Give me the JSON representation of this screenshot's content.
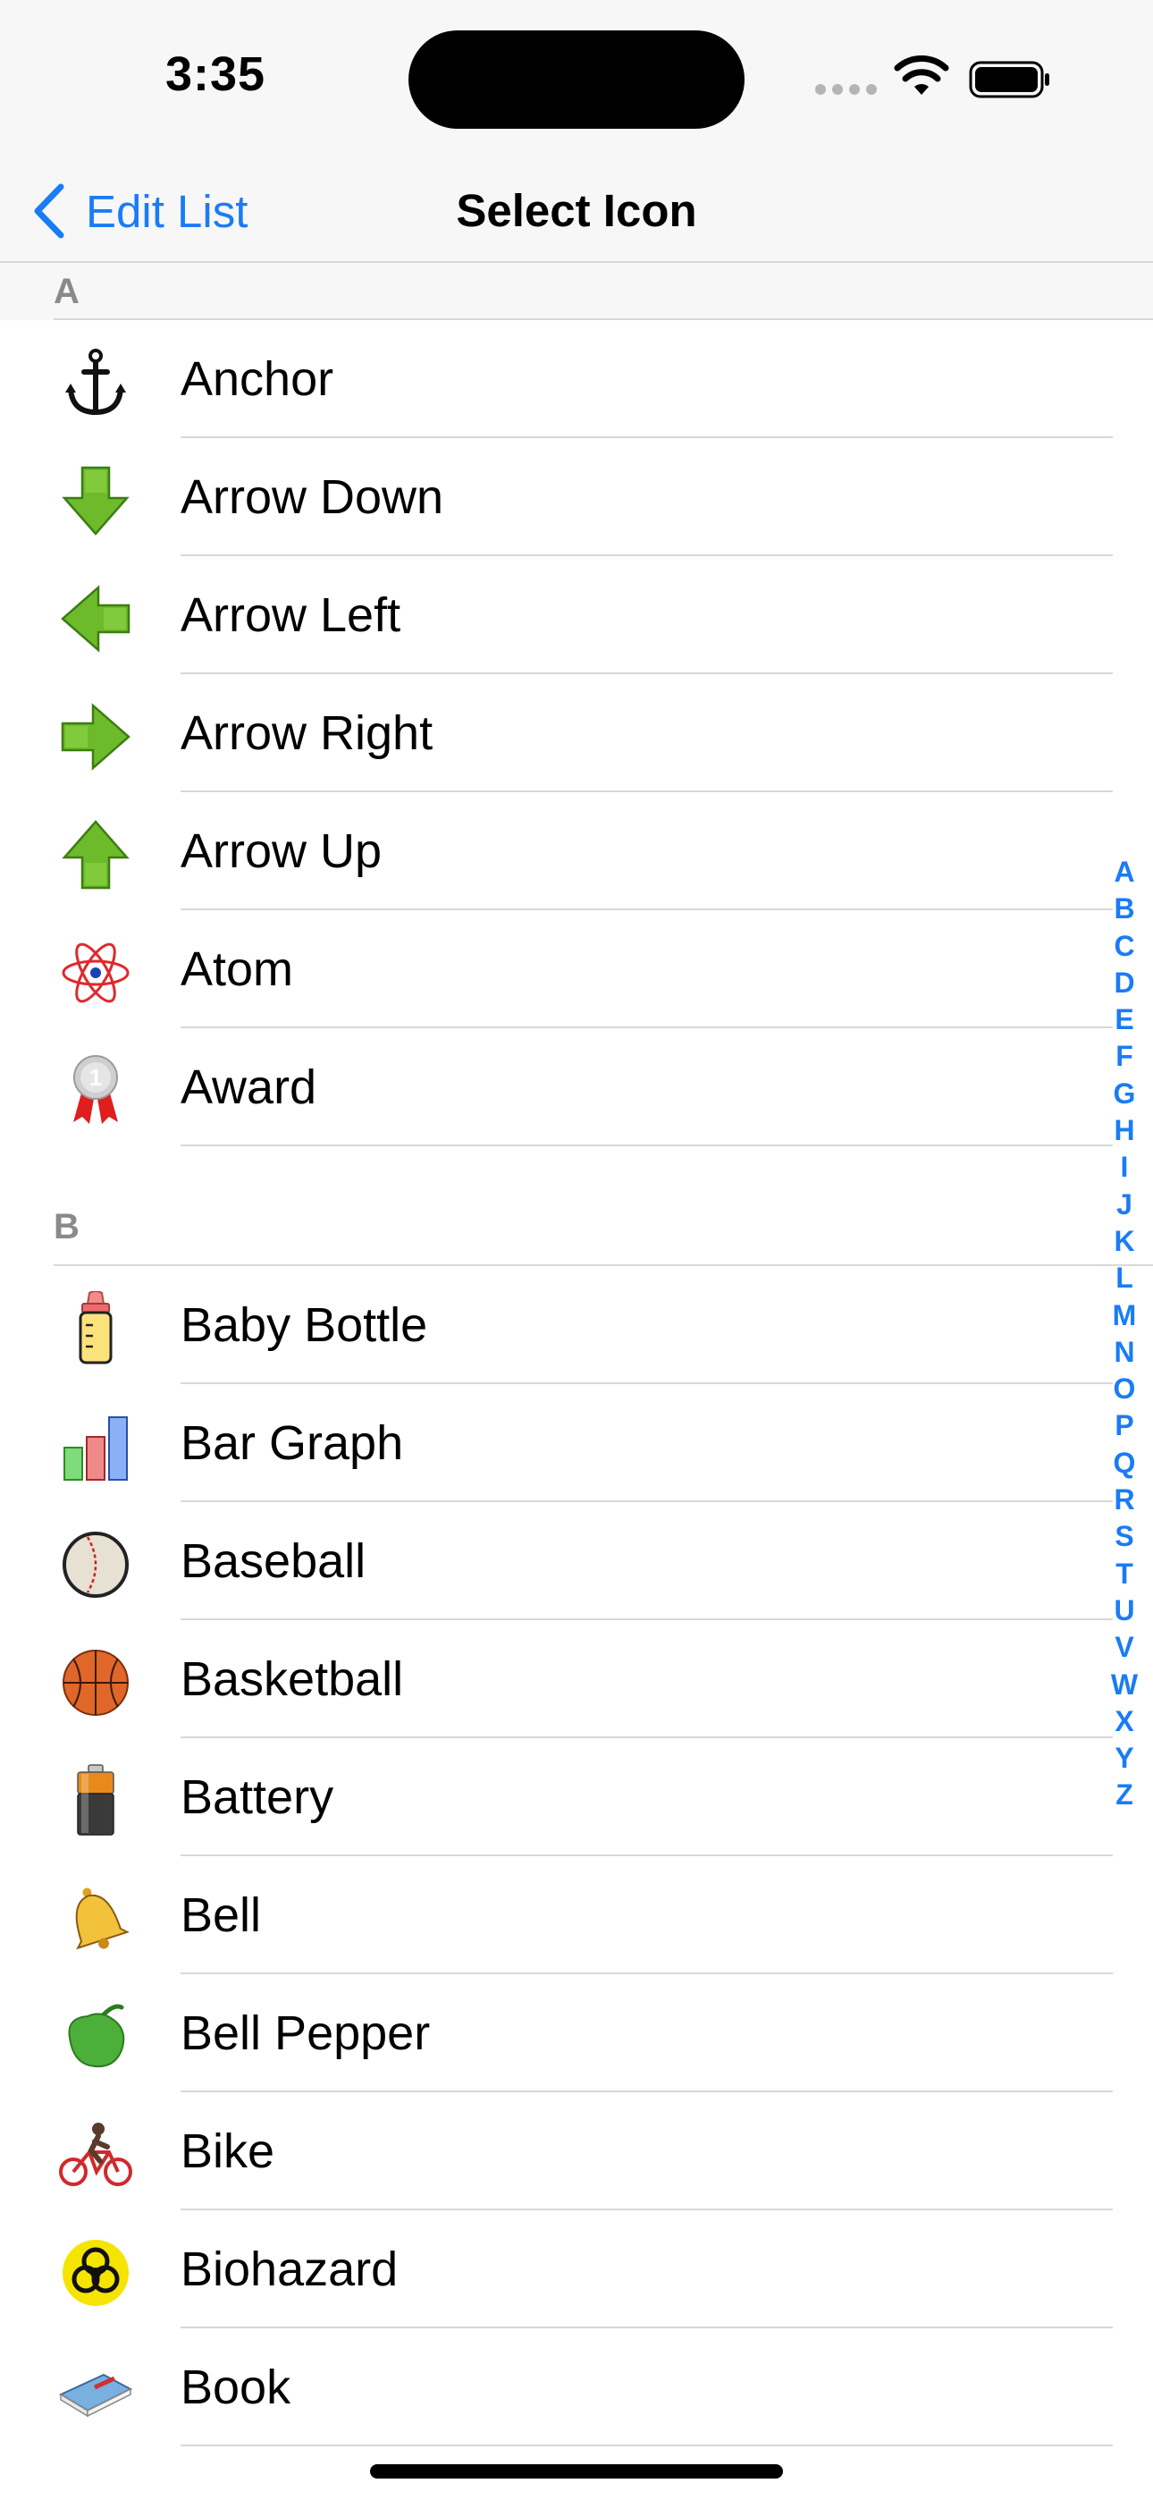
{
  "status": {
    "time": "3:35"
  },
  "nav": {
    "back_label": "Edit List",
    "title": "Select Icon"
  },
  "sections": [
    {
      "header": "A",
      "items": [
        {
          "label": "Anchor",
          "icon": "anchor-icon"
        },
        {
          "label": "Arrow Down",
          "icon": "arrow-down-icon"
        },
        {
          "label": "Arrow Left",
          "icon": "arrow-left-icon"
        },
        {
          "label": "Arrow Right",
          "icon": "arrow-right-icon"
        },
        {
          "label": "Arrow Up",
          "icon": "arrow-up-icon"
        },
        {
          "label": "Atom",
          "icon": "atom-icon"
        },
        {
          "label": "Award",
          "icon": "award-icon",
          "badge": "1"
        }
      ]
    },
    {
      "header": "B",
      "items": [
        {
          "label": "Baby Bottle",
          "icon": "baby-bottle-icon"
        },
        {
          "label": "Bar Graph",
          "icon": "bar-graph-icon"
        },
        {
          "label": "Baseball",
          "icon": "baseball-icon"
        },
        {
          "label": "Basketball",
          "icon": "basketball-icon"
        },
        {
          "label": "Battery",
          "icon": "battery-icon"
        },
        {
          "label": "Bell",
          "icon": "bell-icon"
        },
        {
          "label": "Bell Pepper",
          "icon": "bell-pepper-icon"
        },
        {
          "label": "Bike",
          "icon": "bike-icon"
        },
        {
          "label": "Biohazard",
          "icon": "biohazard-icon"
        },
        {
          "label": "Book",
          "icon": "book-icon"
        }
      ]
    }
  ],
  "index": [
    "A",
    "B",
    "C",
    "D",
    "E",
    "F",
    "G",
    "H",
    "I",
    "J",
    "K",
    "L",
    "M",
    "N",
    "O",
    "P",
    "Q",
    "R",
    "S",
    "T",
    "U",
    "V",
    "W",
    "X",
    "Y",
    "Z"
  ],
  "colors": {
    "accent": "#1a7cf5",
    "bar_background": "#f7f7f7",
    "separator": "#d8d8d8",
    "section_header_text": "#8a8a8e"
  }
}
